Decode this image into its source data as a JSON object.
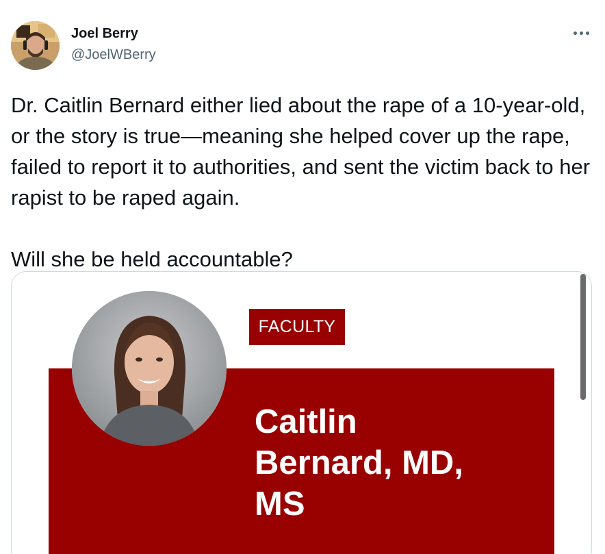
{
  "author": {
    "name": "Joel Berry",
    "handle": "@JoelWBerry"
  },
  "tweet": {
    "paragraph_1": "Dr. Caitlin Bernard either lied about the rape of a 10-year-old, or the story is true—meaning she helped cover up the rape, failed to report it to authorities, and sent the victim back to her rapist to be raped again.",
    "paragraph_2": "Will she be held accountable?"
  },
  "media": {
    "badge": "FACULTY",
    "name_line_1": "Caitlin",
    "name_line_2": "Bernard, MD,",
    "name_line_3": "MS"
  },
  "icons": {
    "more": "more-horizontal-icon"
  },
  "colors": {
    "brand_red": "#990000",
    "text": "#0f1419",
    "secondary_text": "#536471",
    "border": "#cfd9de"
  }
}
